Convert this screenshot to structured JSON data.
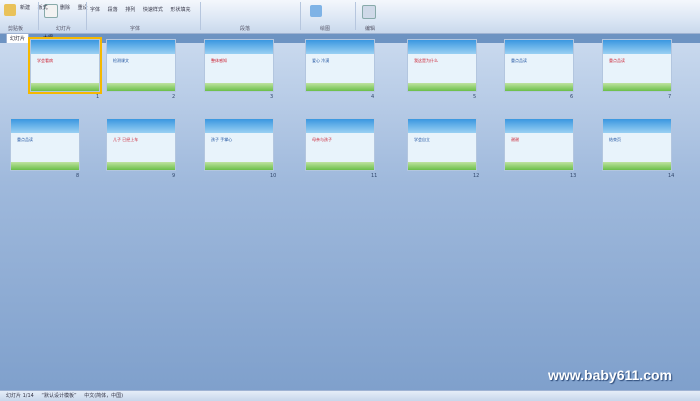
{
  "ribbon": {
    "row1": [
      "新建",
      "板式",
      "删除",
      "重设"
    ],
    "row2": [
      "字体",
      "段落",
      "排列",
      "快速样式",
      "形状填充"
    ],
    "groups": [
      "剪贴板",
      "幻灯片",
      "字体",
      "段落",
      "绘图",
      "编辑"
    ]
  },
  "tabs": [
    "幻灯片",
    "大纲"
  ],
  "slides": [
    {
      "num": "1",
      "title": "学会看病"
    },
    {
      "num": "2",
      "title": "检测课文"
    },
    {
      "num": "3",
      "title": "整体感知"
    },
    {
      "num": "4",
      "title": "爱心 冷漠"
    },
    {
      "num": "5",
      "title": "我这是为什么"
    },
    {
      "num": "6",
      "title": "重点品读"
    },
    {
      "num": "7",
      "title": "重点品读"
    },
    {
      "num": "8",
      "title": "重点品读"
    },
    {
      "num": "9",
      "title": "儿子 已经上车"
    },
    {
      "num": "10",
      "title": "孩子 手掌心"
    },
    {
      "num": "11",
      "title": "母亲与孩子"
    },
    {
      "num": "12",
      "title": "学会自立"
    },
    {
      "num": "13",
      "title": "谢谢"
    },
    {
      "num": "14",
      "title": "结束页"
    }
  ],
  "status": {
    "slide_info": "幻灯片 1/14",
    "theme": "“默认设计模板”",
    "lang": "中文(简体，中国)"
  },
  "watermark": "www.baby611.com"
}
